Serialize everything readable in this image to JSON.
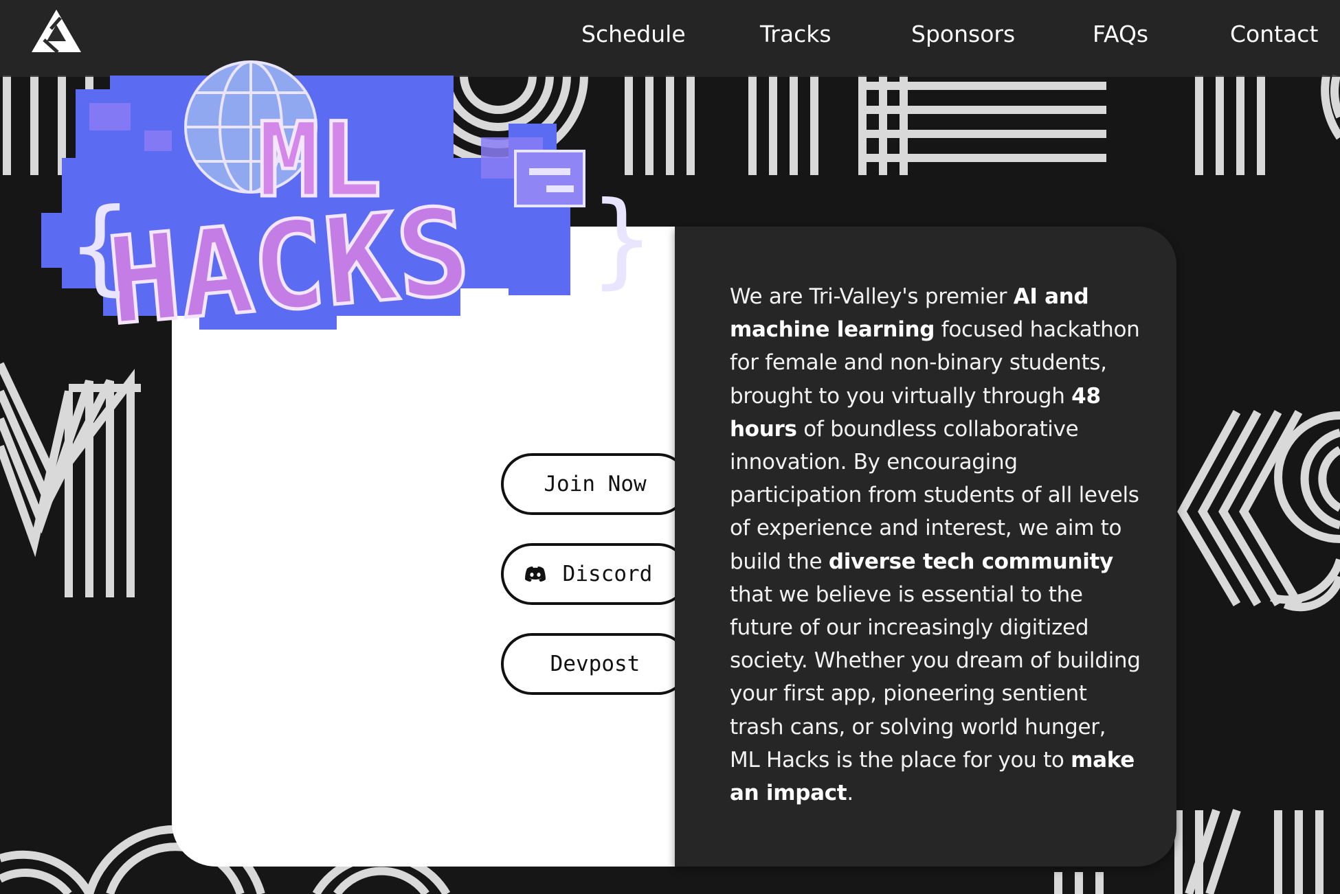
{
  "nav": {
    "logo_icon": "triangle-logo-icon",
    "links": [
      "Schedule",
      "Tracks",
      "Sponsors",
      "FAQs",
      "Contact"
    ]
  },
  "hero": {
    "logo_text_top": "ML",
    "logo_text_bottom": "HACKS",
    "logo_colors": {
      "blue": "#5b6cf2",
      "purple": "#b66ee8",
      "pink": "#e07be6"
    }
  },
  "buttons": {
    "join": "Join Now",
    "discord": "Discord",
    "discord_icon": "discord-icon",
    "devpost": "Devpost"
  },
  "about": {
    "segments": [
      {
        "t": "We are Tri-Valley's premier ",
        "b": false
      },
      {
        "t": "AI and machine learning",
        "b": true
      },
      {
        "t": " focused hackathon for female and non-binary students, brought to you virtually through ",
        "b": false
      },
      {
        "t": "48 hours",
        "b": true
      },
      {
        "t": " of boundless collaborative innovation. By encouraging participation from students of all levels of experience and interest, we aim to build the ",
        "b": false
      },
      {
        "t": "diverse tech community",
        "b": true
      },
      {
        "t": " that we believe is essential to the future of our increasingly digitized society. Whether you dream of building your first app, pioneering sentient trash cans, or solving world hunger, ML Hacks is the place for you to ",
        "b": false
      },
      {
        "t": "make an impact",
        "b": true
      },
      {
        "t": ".",
        "b": false
      }
    ]
  },
  "colors": {
    "background": "#161616",
    "nav": "#282828",
    "card_dark": "#262626",
    "card_light": "#ffffff"
  }
}
